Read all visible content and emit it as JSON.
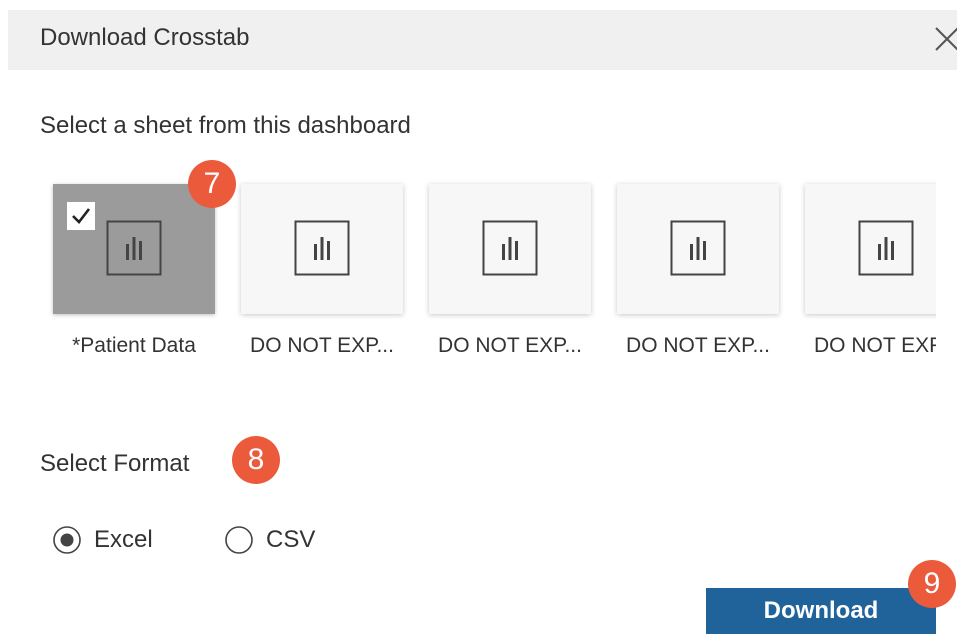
{
  "dialog": {
    "title": "Download Crosstab",
    "close_icon": "close-icon"
  },
  "sheets_section": {
    "label": "Select a sheet from this dashboard",
    "sheets": [
      {
        "label": "*Patient Data",
        "selected": true,
        "icon": "bar-chart-icon"
      },
      {
        "label": "DO NOT EXP...",
        "selected": false,
        "icon": "bar-chart-icon"
      },
      {
        "label": "DO NOT EXP...",
        "selected": false,
        "icon": "bar-chart-icon"
      },
      {
        "label": "DO NOT EXP...",
        "selected": false,
        "icon": "bar-chart-icon"
      },
      {
        "label": "DO NOT EXP",
        "selected": false,
        "icon": "bar-chart-icon"
      }
    ]
  },
  "format_section": {
    "label": "Select Format",
    "options": [
      {
        "label": "Excel",
        "selected": true
      },
      {
        "label": "CSV",
        "selected": false
      }
    ]
  },
  "download_button": {
    "label": "Download"
  },
  "step_badges": [
    "7",
    "8",
    "9"
  ],
  "colors": {
    "accent": "#20639b",
    "badge": "#ec5a3c",
    "selected_thumb": "#9b9b9b",
    "header_bg": "#f0f0f0"
  }
}
